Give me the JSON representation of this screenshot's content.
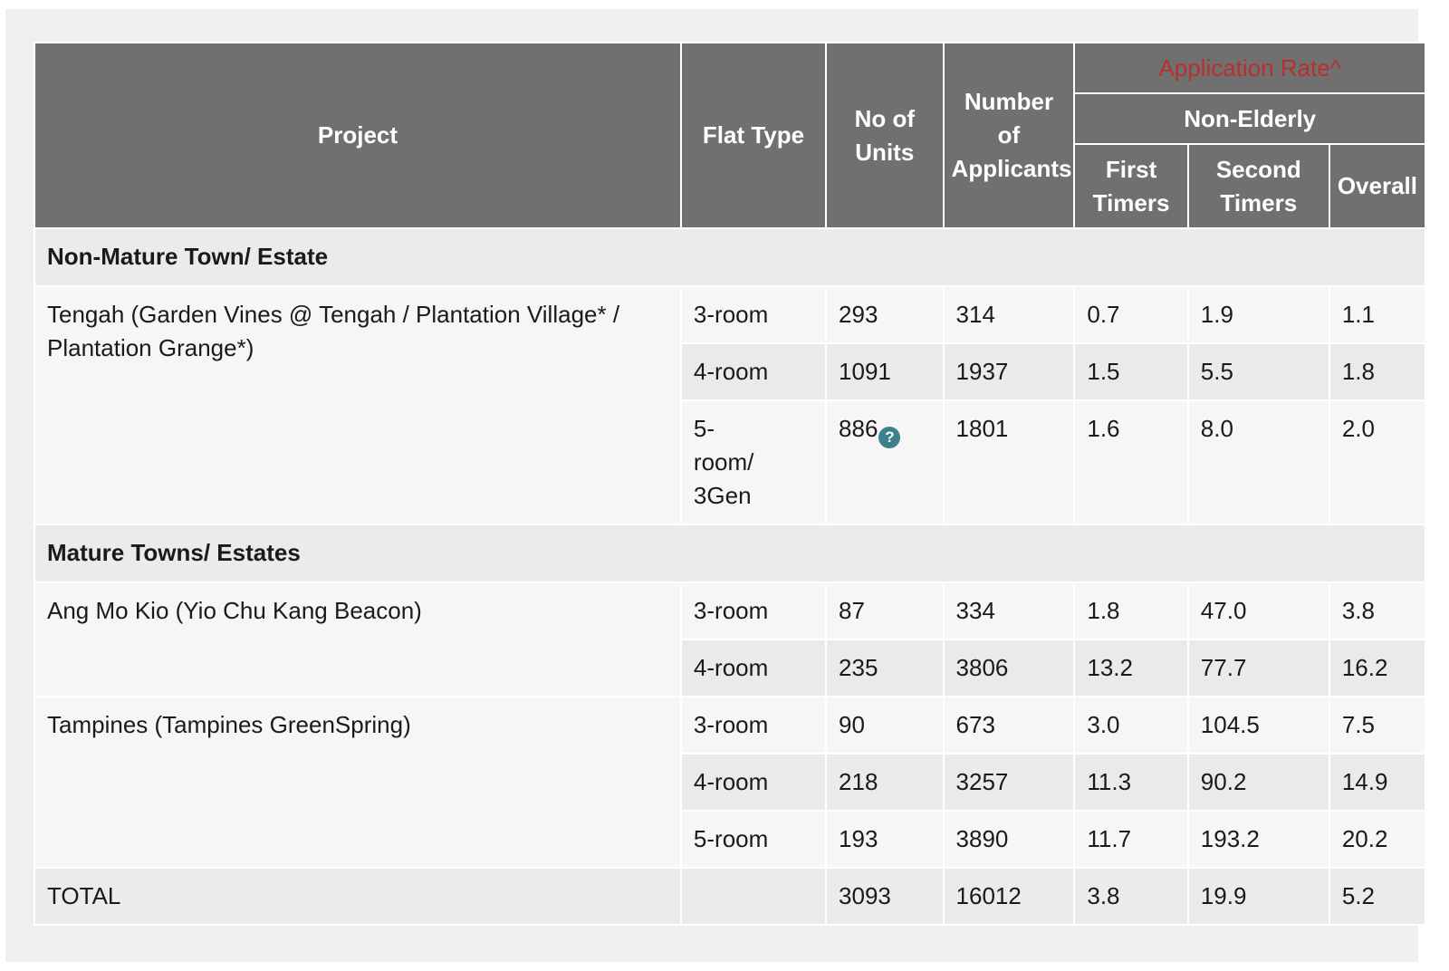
{
  "header": {
    "project": "Project",
    "flat_type": "Flat Type",
    "no_of_units": "No of Units",
    "number_of_applicants": "Number of Applicants",
    "application_rate": "Application Rate^",
    "non_elderly": "Non-Elderly",
    "first_timers": "First Timers",
    "second_timers": "Second Timers",
    "overall": "Overall"
  },
  "colors": {
    "header_bg": "#707070",
    "application_rate_text": "#b8302e",
    "help_icon": "#3e7f8c"
  },
  "sections": [
    {
      "title": "Non-Mature Town/ Estate",
      "projects": [
        {
          "name": "Tengah (Garden Vines @ Tengah / Plantation Village* / Plantation Grange*)",
          "rows": [
            {
              "flat_type": "3-room",
              "units": "293",
              "applicants": "314",
              "first_timers": "0.7",
              "second_timers": "1.9",
              "overall": "1.1"
            },
            {
              "flat_type": "4-room",
              "units": "1091",
              "applicants": "1937",
              "first_timers": "1.5",
              "second_timers": "5.5",
              "overall": "1.8"
            },
            {
              "flat_type": "5-room/ 3Gen",
              "units": "886",
              "units_help_icon": "question-circle-icon",
              "applicants": "1801",
              "first_timers": "1.6",
              "second_timers": "8.0",
              "overall": "2.0"
            }
          ]
        }
      ]
    },
    {
      "title": "Mature Towns/ Estates",
      "projects": [
        {
          "name": "Ang Mo Kio (Yio Chu Kang Beacon)",
          "rows": [
            {
              "flat_type": "3-room",
              "units": "87",
              "applicants": "334",
              "first_timers": "1.8",
              "second_timers": "47.0",
              "overall": "3.8"
            },
            {
              "flat_type": "4-room",
              "units": "235",
              "applicants": "3806",
              "first_timers": "13.2",
              "second_timers": "77.7",
              "overall": "16.2"
            }
          ]
        },
        {
          "name": "Tampines (Tampines GreenSpring)",
          "rows": [
            {
              "flat_type": "3-room",
              "units": "90",
              "applicants": "673",
              "first_timers": "3.0",
              "second_timers": "104.5",
              "overall": "7.5"
            },
            {
              "flat_type": "4-room",
              "units": "218",
              "applicants": "3257",
              "first_timers": "11.3",
              "second_timers": "90.2",
              "overall": "14.9"
            },
            {
              "flat_type": "5-room",
              "units": "193",
              "applicants": "3890",
              "first_timers": "11.7",
              "second_timers": "193.2",
              "overall": "20.2"
            }
          ]
        }
      ]
    }
  ],
  "total": {
    "label": "TOTAL",
    "units": "3093",
    "applicants": "16012",
    "first_timers": "3.8",
    "second_timers": "19.9",
    "overall": "5.2"
  }
}
